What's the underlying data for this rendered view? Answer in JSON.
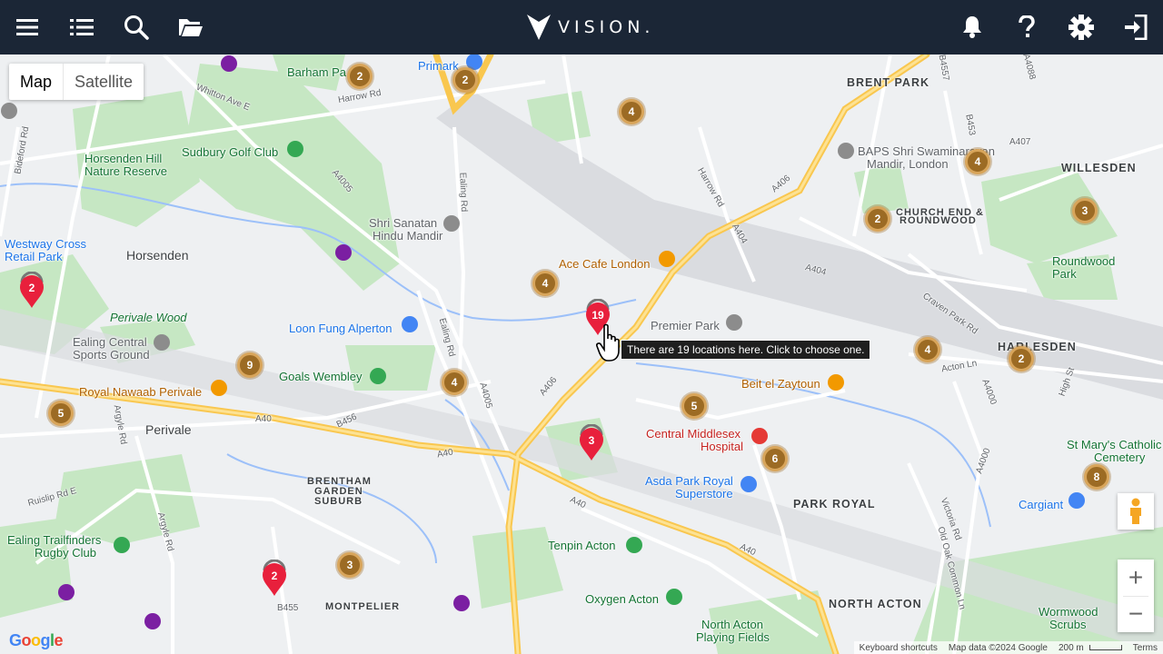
{
  "app": {
    "brand": "VISION.",
    "topbar_icons": [
      "menu-icon",
      "list-icon",
      "search-icon",
      "folder-icon",
      "bell-icon",
      "help-icon",
      "gear-icon",
      "logout-icon"
    ]
  },
  "map_controls": {
    "map_tab": "Map",
    "satellite_tab": "Satellite",
    "zoom_in": "+",
    "zoom_out": "−",
    "tooltip": "There are 19 locations here. Click to choose one."
  },
  "attribution": {
    "shortcuts": "Keyboard shortcuts",
    "data": "Map data ©2024 Google",
    "scale": "200 m",
    "terms": "Terms",
    "google": "Google"
  },
  "place_labels": {
    "brent_park": "BRENT PARK",
    "willesden": "WILLESDEN",
    "church_end": "CHURCH END &",
    "roundwood_area": "ROUNDWOOD",
    "harlesden": "HARLESDEN",
    "park_royal": "PARK ROYAL",
    "north_acton": "NORTH ACTON",
    "montpelier": "MONTPELIER",
    "brentham1": "BRENTHAM",
    "brentham2": "GARDEN",
    "brentham3": "SUBURB",
    "horsenden": "Horsenden",
    "perivale": "Perivale",
    "barham_park": "Barham Pa",
    "primark": "Primark",
    "sudbury_golf": "Sudbury Golf Club",
    "horsenden_hill1": "Horsenden Hill",
    "horsenden_hill2": "Nature Reserve",
    "shri_sanatan1": "Shri Sanatan",
    "shri_sanatan2": "Hindu Mandir",
    "westway1": "Westway Cross",
    "westway2": "Retail Park",
    "perivale_wood": "Perivale Wood",
    "loon_fung": "Loon Fung Alperton",
    "ealing_central1": "Ealing Central",
    "ealing_central2": "Sports Ground",
    "goals_wembley": "Goals Wembley",
    "royal_nawaab": "Royal Nawaab Perivale",
    "ace_cafe": "Ace Cafe London",
    "premier_park": "Premier Park",
    "beit_el_zaytoun": "Beit el Zaytoun",
    "central_middlesex1": "Central Middlesex",
    "central_middlesex2": "Hospital",
    "asda1": "Asda Park Royal",
    "asda2": "Superstore",
    "baps1": "BAPS Shri Swaminarayan",
    "baps2": "Mandir, London",
    "roundwood_park1": "Roundwood",
    "roundwood_park2": "Park",
    "st_marys1": "St Mary's Catholic",
    "st_marys2": "Cemetery",
    "cargiant": "Cargiant",
    "tenpin": "Tenpin Acton",
    "oxygen": "Oxygen Acton",
    "north_acton_pf1": "North Acton",
    "north_acton_pf2": "Playing Fields",
    "wormwood1": "Wormwood",
    "wormwood2": "Scrubs",
    "ealing_trail1": "Ealing Trailfinders",
    "ealing_trail2": "Rugby Club"
  },
  "road_labels": {
    "a406a": "A406",
    "a406b": "A406",
    "a40a": "A40",
    "a40b": "A40",
    "a40c": "A40",
    "a40d": "A40",
    "a404a": "A404",
    "a404b": "A404",
    "a4005a": "A4005",
    "a4005b": "A4005",
    "a4000a": "A4000",
    "a4000b": "A4000",
    "a407": "A407",
    "a4088": "A4088",
    "b453": "B453",
    "b456": "B456",
    "b455": "B455",
    "b4557": "B4557",
    "harrow_rd": "Harrow Rd",
    "harrow_rd2": "Harrow Rd",
    "ealing_rd": "Ealing Rd",
    "ealing_rd2": "Ealing Rd",
    "whitton": "Whitton Ave E",
    "craven_park": "Craven Park Rd",
    "acton_ln": "Acton Ln",
    "high_st": "High St",
    "victoria_rd": "Victoria Rd",
    "old_oak": "Old Oak Common Ln",
    "argyle1": "Argyle Rd",
    "argyle2": "Argyle Rd",
    "ruislip": "Ruislip Rd E",
    "bideford": "Bideford Rd"
  },
  "clusters": [
    {
      "count": "2"
    },
    {
      "count": "2"
    },
    {
      "count": "4"
    },
    {
      "count": "4"
    },
    {
      "count": "3"
    },
    {
      "count": "2"
    },
    {
      "count": "4"
    },
    {
      "count": "4"
    },
    {
      "count": "2"
    },
    {
      "count": "9"
    },
    {
      "count": "4"
    },
    {
      "count": "5"
    },
    {
      "count": "5"
    },
    {
      "count": "6"
    },
    {
      "count": "8"
    },
    {
      "count": "3"
    }
  ],
  "pins": [
    {
      "count": "2"
    },
    {
      "count": "19"
    },
    {
      "count": "3"
    },
    {
      "count": "2"
    }
  ],
  "colors": {
    "topbar": "#1b2636",
    "cluster": "#9c6b24",
    "pin": "#e8203c",
    "major_road": "#fdd663",
    "park": "#c8e6c9"
  }
}
